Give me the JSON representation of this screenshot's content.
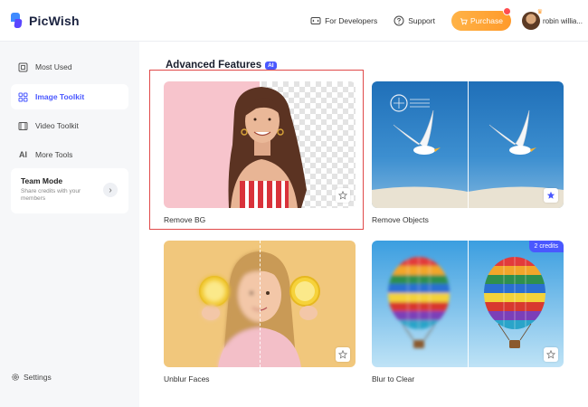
{
  "app": {
    "name": "PicWish"
  },
  "header": {
    "developers_label": "For Developers",
    "support_label": "Support",
    "purchase_label": "Purchase",
    "user_name": "robin willia..."
  },
  "sidebar": {
    "items": [
      {
        "label": "Most Used",
        "icon": "image-frame-icon"
      },
      {
        "label": "Image Toolkit",
        "icon": "grid-icon"
      },
      {
        "label": "Video Toolkit",
        "icon": "film-icon"
      },
      {
        "label": "More Tools",
        "icon": "ai-icon"
      }
    ],
    "team": {
      "title": "Team Mode",
      "description": "Share credits with your members"
    },
    "settings_label": "Settings"
  },
  "main": {
    "section_title": "Advanced Features",
    "section_badge": "AI",
    "cards": [
      {
        "label": "Remove BG",
        "selected": true,
        "favorite": false
      },
      {
        "label": "Remove Objects",
        "favorite": true
      },
      {
        "label": "Unblur Faces",
        "favorite": false
      },
      {
        "label": "Blur to Clear",
        "favorite": false,
        "badge": "2 credits"
      }
    ]
  },
  "colors": {
    "accent": "#4a58ff",
    "purchase": "#ff9a2a",
    "selection": "#e04a4a"
  }
}
